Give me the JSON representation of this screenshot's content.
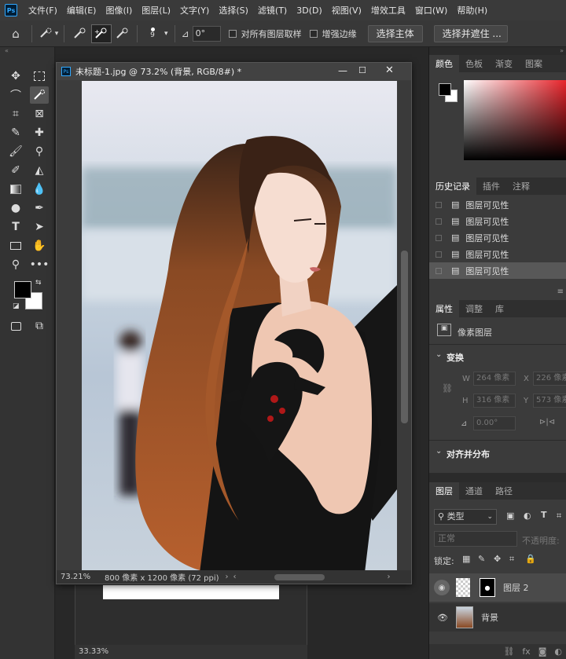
{
  "menubar": {
    "logo": "Ps",
    "items": [
      "文件(F)",
      "编辑(E)",
      "图像(I)",
      "图层(L)",
      "文字(Y)",
      "选择(S)",
      "滤镜(T)",
      "3D(D)",
      "视图(V)",
      "增效工具",
      "窗口(W)",
      "帮助(H)"
    ]
  },
  "options": {
    "brush_size": "9",
    "angle_value": "0°",
    "sample_all_layers": "对所有图层取样",
    "enhance_edge": "增强边缘",
    "select_subject": "选择主体",
    "select_and_mask": "选择并遮住 ..."
  },
  "document": {
    "title": "未标题-1.jpg @ 73.2% (背景, RGB/8#) *",
    "zoom": "73.21%",
    "size_info": "800 像素 x 1200 像素 (72 ppi)",
    "second_zoom": "33.33%"
  },
  "panels": {
    "color_tabs": [
      "颜色",
      "色板",
      "渐变",
      "图案"
    ],
    "history_tabs": [
      "历史记录",
      "插件",
      "注释"
    ],
    "history_items": [
      "图层可见性",
      "图层可见性",
      "图层可见性",
      "图层可见性",
      "图层可见性"
    ],
    "props_tabs": [
      "属性",
      "调整",
      "库"
    ],
    "pixel_layer": "像素图层",
    "transform": "变换",
    "w_label": "W",
    "w_value": "264 像素",
    "x_label": "X",
    "x_value": "226 像素",
    "h_label": "H",
    "h_value": "316 像素",
    "y_label": "Y",
    "y_value": "573 像素",
    "angle": "0.00°",
    "align": "对齐并分布",
    "layers_tabs": [
      "图层",
      "通道",
      "路径"
    ],
    "filter_kind": "类型",
    "blend_mode": "正常",
    "opacity_label": "不透明度:",
    "lock_label": "锁定:",
    "layers": [
      "图层 2",
      "背景"
    ]
  },
  "colors": {
    "accent": "#31a8ff",
    "fg": "#000000",
    "bg": "#ffffff"
  }
}
